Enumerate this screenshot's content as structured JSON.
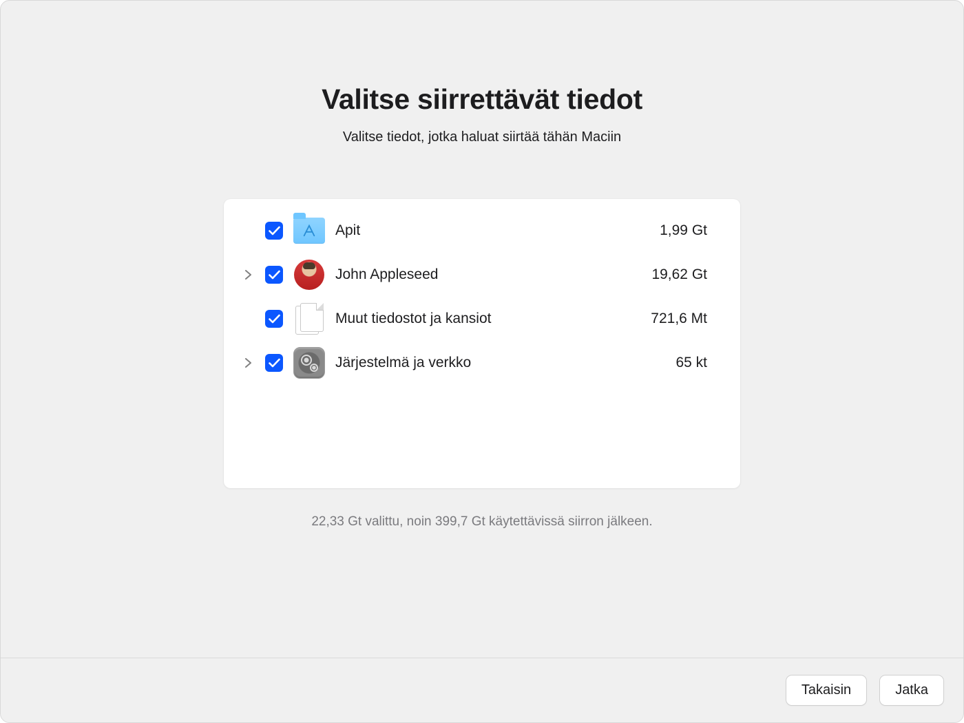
{
  "title": "Valitse siirrettävät tiedot",
  "subtitle": "Valitse tiedot, jotka haluat siirtää tähän Maciin",
  "items": [
    {
      "label": "Apit",
      "size": "1,99 Gt",
      "expandable": false,
      "checked": true,
      "icon": "folder-apps"
    },
    {
      "label": "John Appleseed",
      "size": "19,62 Gt",
      "expandable": true,
      "checked": true,
      "icon": "avatar"
    },
    {
      "label": "Muut tiedostot ja kansiot",
      "size": "721,6 Mt",
      "expandable": false,
      "checked": true,
      "icon": "file-stack"
    },
    {
      "label": "Järjestelmä ja verkko",
      "size": "65 kt",
      "expandable": true,
      "checked": true,
      "icon": "gears"
    }
  ],
  "summary": "22,33 Gt valittu, noin 399,7 Gt käytettävissä siirron jälkeen.",
  "buttons": {
    "back": "Takaisin",
    "continue": "Jatka"
  }
}
